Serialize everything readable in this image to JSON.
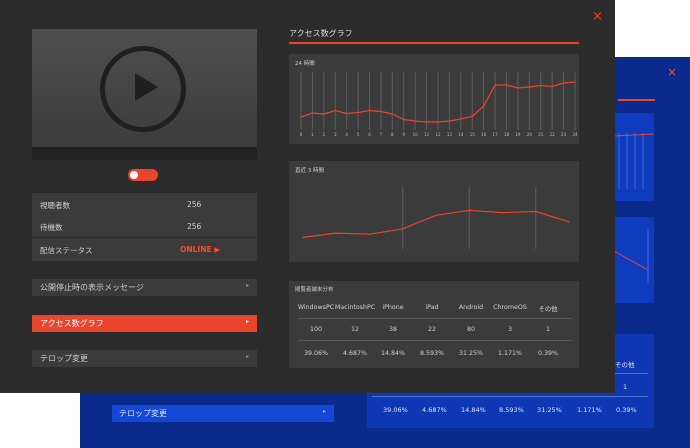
{
  "colors": {
    "accent": "#e8452c",
    "panel": "#3b3b3b",
    "window": "#2c2c2c",
    "back_window": "#0a2b8c"
  },
  "icons": {
    "close": "close-icon",
    "play": "play-icon",
    "chevron": "chevron-right-icon"
  },
  "front": {
    "close_glyph": "×",
    "stats": [
      {
        "label": "視聴者数",
        "value": "256"
      },
      {
        "label": "待機数",
        "value": "256"
      },
      {
        "label": "配信ステータス",
        "value": "ONLINE ▶"
      }
    ],
    "menu": [
      {
        "label": "公開停止時の表示メッセージ",
        "arrow": "▸"
      },
      {
        "label": "アクセス数グラフ",
        "arrow": "▸"
      },
      {
        "label": "テロップ変更",
        "arrow": "▸"
      }
    ],
    "graph_title": "アクセス数グラフ",
    "share_title": "閲覧者端末分布",
    "share_headers": [
      "WindowsPC",
      "MacintoshPC",
      "iPhone",
      "iPad",
      "Android",
      "ChromeOS",
      "その他"
    ],
    "share_counts": [
      "100",
      "12",
      "38",
      "22",
      "80",
      "3",
      "1"
    ],
    "share_percents": [
      "39.06%",
      "4.687%",
      "14.84%",
      "8.593%",
      "31.25%",
      "1.171%",
      "0.39%"
    ]
  },
  "back": {
    "close_glyph": "×",
    "telop_label": "テロップ変更",
    "telop_arrow": "▸",
    "other_header": "その他",
    "other_count": "1",
    "percents": [
      "39.06%",
      "4.687%",
      "14.84%",
      "8.593%",
      "31.25%",
      "1.171%",
      "0.39%"
    ]
  },
  "chart_data": [
    {
      "type": "line",
      "title": "24 時間",
      "x": [
        "0",
        "1",
        "2",
        "3",
        "4",
        "5",
        "6",
        "7",
        "8",
        "9",
        "10",
        "11",
        "12",
        "13",
        "14",
        "15",
        "16",
        "17",
        "18",
        "19",
        "20",
        "21",
        "22",
        "23",
        "24"
      ],
      "values": [
        18,
        26,
        24,
        31,
        25,
        27,
        31,
        29,
        24,
        13,
        10,
        8,
        8,
        10,
        14,
        19,
        40,
        82,
        82,
        76,
        78,
        81,
        79,
        86,
        88
      ],
      "ylim": [
        0,
        100
      ],
      "grid": "vertical"
    },
    {
      "type": "line",
      "title": "直近 3 時間",
      "values": [
        14,
        22,
        20,
        30,
        55,
        64,
        60,
        62,
        43
      ],
      "ylim": [
        0,
        100
      ],
      "grid": "vertical"
    }
  ]
}
